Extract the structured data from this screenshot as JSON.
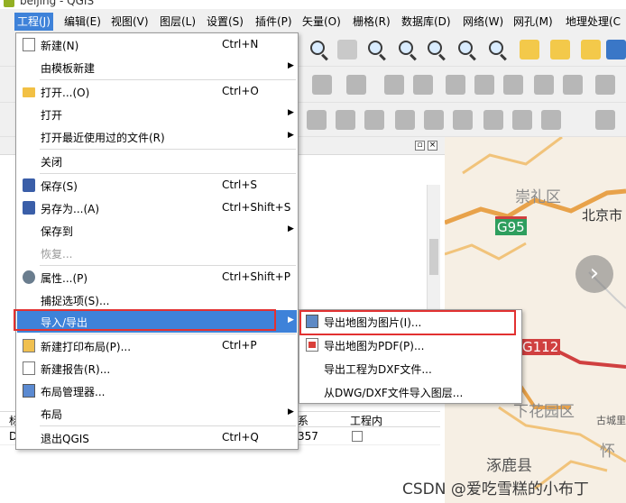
{
  "window": {
    "title": "beijing - QGIS"
  },
  "menubar": {
    "items": [
      "工程(J)",
      "编辑(E)",
      "视图(V)",
      "图层(L)",
      "设置(S)",
      "插件(P)",
      "矢量(O)",
      "栅格(R)",
      "数据库(D)",
      "网络(W)",
      "网孔(M)",
      "地理处理(C"
    ]
  },
  "project_menu": {
    "items": [
      {
        "label": "新建(N)",
        "shortcut": "Ctrl+N",
        "icon": "new-file-icon"
      },
      {
        "label": "由模板新建",
        "shortcut": "",
        "icon": ""
      },
      {
        "label": "打开...(O)",
        "shortcut": "Ctrl+O",
        "icon": "open-folder-icon"
      },
      {
        "label": "打开",
        "shortcut": "",
        "icon": ""
      },
      {
        "label": "打开最近使用过的文件(R)",
        "shortcut": "",
        "icon": ""
      },
      {
        "label": "关闭",
        "shortcut": "",
        "icon": ""
      },
      {
        "label": "保存(S)",
        "shortcut": "Ctrl+S",
        "icon": "save-icon"
      },
      {
        "label": "另存为...(A)",
        "shortcut": "Ctrl+Shift+S",
        "icon": "save-as-icon"
      },
      {
        "label": "保存到",
        "shortcut": "",
        "icon": ""
      },
      {
        "label": "恢复...",
        "shortcut": "",
        "icon": ""
      },
      {
        "label": "属性...(P)",
        "shortcut": "Ctrl+Shift+P",
        "icon": "properties-icon"
      },
      {
        "label": "捕捉选项(S)...",
        "shortcut": "",
        "icon": ""
      },
      {
        "label": "导入/导出",
        "shortcut": "",
        "icon": ""
      },
      {
        "label": "新建打印布局(P)...",
        "shortcut": "Ctrl+P",
        "icon": "print-layout-icon"
      },
      {
        "label": "新建报告(R)...",
        "shortcut": "",
        "icon": "report-icon"
      },
      {
        "label": "布局管理器...",
        "shortcut": "",
        "icon": "layout-manager-icon"
      },
      {
        "label": "布局",
        "shortcut": "",
        "icon": ""
      },
      {
        "label": "退出QGIS",
        "shortcut": "Ctrl+Q",
        "icon": ""
      }
    ]
  },
  "import_export_submenu": {
    "items": [
      {
        "label": "导出地图为图片(I)...",
        "icon": "export-image-icon"
      },
      {
        "label": "导出地图为PDF(P)...",
        "icon": "export-pdf-icon"
      },
      {
        "label": "导出工程为DXF文件...",
        "icon": ""
      },
      {
        "label": "从DWG/DXF文件导入图层...",
        "icon": ""
      }
    ]
  },
  "table": {
    "headers": [
      "标",
      "系",
      "工程内"
    ],
    "row": [
      "D",
      "357",
      ""
    ]
  },
  "map": {
    "labels": [
      "崇礼区",
      "北京市",
      "G95",
      "G112",
      "下花园区",
      "古城里",
      "涿鹿县",
      "怀"
    ]
  },
  "watermark": "CSDN @爱吃雪糕的小布丁",
  "colors": {
    "highlight": "#3e82d9",
    "redbox": "#e23131",
    "road_orange": "#e8a24a",
    "road_green": "#2e9e5e",
    "road_red": "#d04040"
  }
}
